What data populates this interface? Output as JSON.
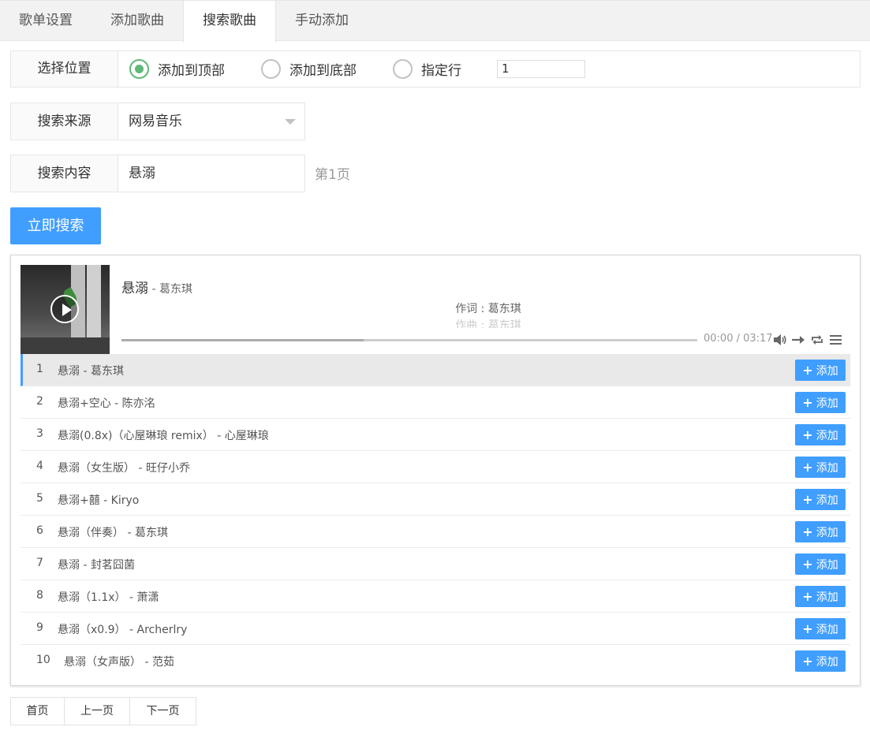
{
  "tabs": [
    {
      "label": "歌单设置"
    },
    {
      "label": "添加歌曲"
    },
    {
      "label": "搜索歌曲",
      "active": true
    },
    {
      "label": "手动添加"
    }
  ],
  "position": {
    "label": "选择位置",
    "options": [
      "添加到顶部",
      "添加到底部",
      "指定行"
    ],
    "selected": "添加到顶部",
    "line_value": "1"
  },
  "source": {
    "label": "搜索来源",
    "value": "网易音乐"
  },
  "query": {
    "label": "搜索内容",
    "value": "悬溺",
    "page_indicator": "第1页"
  },
  "search_button": "立即搜索",
  "player": {
    "title": "悬溺",
    "artist": " - 葛东琪",
    "lyric_current": "作词 : 葛东琪",
    "lyric_next": "作曲 : 葛东琪",
    "time": "00:00 / 03:17",
    "loaded_fraction": 0.42,
    "icons": [
      "volume-icon",
      "order-icon",
      "loop-icon",
      "menu-icon"
    ]
  },
  "results": [
    {
      "num": "1",
      "name": "悬溺 - 葛东琪"
    },
    {
      "num": "2",
      "name": "悬溺+空心 - 陈亦洺"
    },
    {
      "num": "3",
      "name": "悬溺(0.8x)（心屋琳琅 remix） - 心屋琳琅"
    },
    {
      "num": "4",
      "name": "悬溺（女生版） - 旺仔小乔"
    },
    {
      "num": "5",
      "name": "悬溺+囍 - Kiryo"
    },
    {
      "num": "6",
      "name": "悬溺（伴奏） - 葛东琪"
    },
    {
      "num": "7",
      "name": "悬溺 - 封茗囧菌"
    },
    {
      "num": "8",
      "name": "悬溺（1.1x） - 萧潇"
    },
    {
      "num": "9",
      "name": "悬溺（x0.9） - Archerlry"
    },
    {
      "num": "10",
      "name": "悬溺（女声版） - 范茹"
    }
  ],
  "add_label": "添加",
  "pager": [
    "首页",
    "上一页",
    "下一页"
  ],
  "colors": {
    "accent": "#409eff",
    "radio_checked": "#5fb878"
  }
}
